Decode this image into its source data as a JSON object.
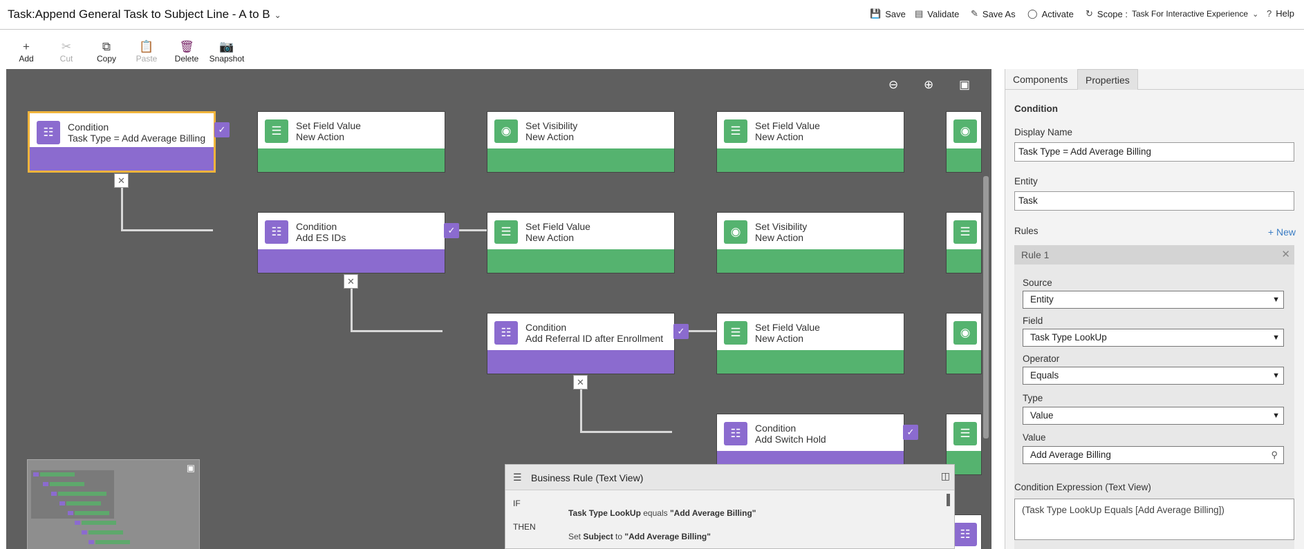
{
  "header": {
    "title": "Task:Append General Task to Subject Line - A to B",
    "commands": [
      {
        "label": "Save",
        "icon": "save-icon"
      },
      {
        "label": "Validate",
        "icon": "validate-icon"
      },
      {
        "label": "Save As",
        "icon": "save-as-icon"
      },
      {
        "label": "Activate",
        "icon": "activate-icon"
      }
    ],
    "scope_label": "Scope :",
    "scope_value": "Task For Interactive Experience",
    "help": "Help"
  },
  "toolbar": {
    "add": "Add",
    "cut": "Cut",
    "copy": "Copy",
    "paste": "Paste",
    "delete": "Delete",
    "snapshot": "Snapshot"
  },
  "canvas": {
    "nodes": [
      {
        "type": "condition",
        "title": "Condition",
        "subtitle": "Task Type = Add Average Billing",
        "selected": true
      },
      {
        "type": "action",
        "title": "Set Field Value",
        "subtitle": "New Action"
      },
      {
        "type": "action",
        "title": "Set Visibility",
        "subtitle": "New Action"
      },
      {
        "type": "action",
        "title": "Set Field Value",
        "subtitle": "New Action"
      },
      {
        "type": "condition",
        "title": "Condition",
        "subtitle": "Add ES IDs"
      },
      {
        "type": "action",
        "title": "Set Field Value",
        "subtitle": "New Action"
      },
      {
        "type": "action",
        "title": "Set Visibility",
        "subtitle": "New Action"
      },
      {
        "type": "condition",
        "title": "Condition",
        "subtitle": "Add Referral ID after Enrollment"
      },
      {
        "type": "action",
        "title": "Set Field Value",
        "subtitle": "New Action"
      },
      {
        "type": "condition",
        "title": "Condition",
        "subtitle": "Add Switch Hold"
      }
    ]
  },
  "business_rule": {
    "title": "Business Rule (Text View)",
    "if_label": "IF",
    "if_field": "Task Type LookUp",
    "if_op": "equals",
    "if_value": "\"Add Average Billing\"",
    "then_label": "THEN",
    "then_set": "Set",
    "then_field": "Subject",
    "then_to": "to",
    "then_value": "\"Add Average Billing\""
  },
  "properties": {
    "tabs": [
      "Components",
      "Properties"
    ],
    "active_tab": "Properties",
    "heading": "Condition",
    "display_name_label": "Display Name",
    "display_name": "Task Type = Add Average Billing",
    "entity_label": "Entity",
    "entity": "Task",
    "rules_label": "Rules",
    "new_link": "+ New",
    "rule": {
      "name": "Rule 1",
      "source_label": "Source",
      "source": "Entity",
      "field_label": "Field",
      "field": "Task Type LookUp",
      "operator_label": "Operator",
      "operator": "Equals",
      "type_label": "Type",
      "type": "Value",
      "value_label": "Value",
      "value": "Add Average Billing"
    },
    "expression_label": "Condition Expression (Text View)",
    "expression": "(Task Type LookUp Equals [Add Average Billing])"
  },
  "colors": {
    "condition": "#8b6bcf",
    "action": "#55b36f",
    "selected": "#f0b43c",
    "canvas": "#5f5f5f"
  }
}
